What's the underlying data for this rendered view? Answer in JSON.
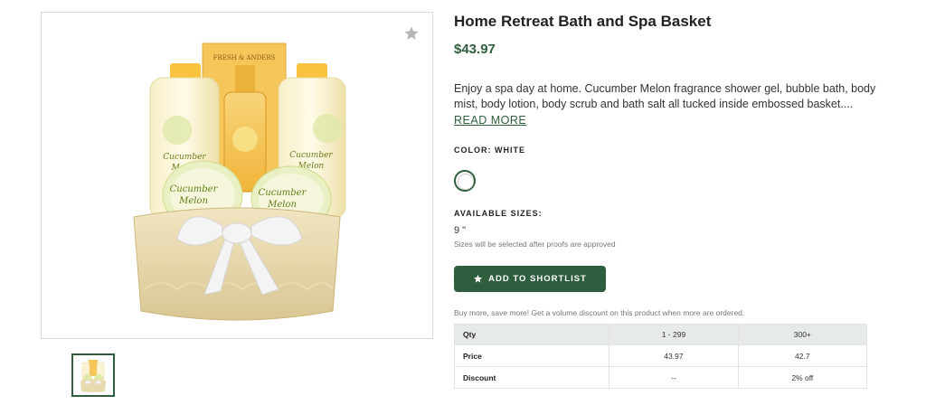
{
  "product": {
    "title": "Home Retreat Bath and Spa Basket",
    "price": "$43.97",
    "description": "Enjoy a spa day at home. Cucumber Melon fragrance shower gel, bubble bath, body mist, body lotion, body scrub and bath salt all tucked inside embossed basket....",
    "read_more": "READ MORE",
    "color_label": "COLOR: WHITE",
    "color_swatch": "#ffffff",
    "sizes_label": "AVAILABLE SIZES:",
    "size_value": "9 \"",
    "size_note": "Sizes will be selected after proofs are approved",
    "shortlist_button": "ADD TO SHORTLIST",
    "volume_note": "Buy more, save more! Get a volume discount on this product when more are ordered."
  },
  "image": {
    "favorite_icon": "star-icon",
    "main_alt": "Spa basket with Cucumber Melon bath products and white bow"
  },
  "labels": {
    "brand": "FRESH & ANDERS",
    "product_line_a": "Cucumber",
    "product_line_b": "Melon"
  },
  "pricing_table": {
    "headers": [
      "Qty",
      "1 - 299",
      "300+"
    ],
    "rows": [
      [
        "Price",
        "43.97",
        "42.7"
      ],
      [
        "Discount",
        "--",
        "2% off"
      ]
    ]
  },
  "colors": {
    "accent": "#2e5e3e",
    "table_header_bg": "#e7ebe8"
  }
}
